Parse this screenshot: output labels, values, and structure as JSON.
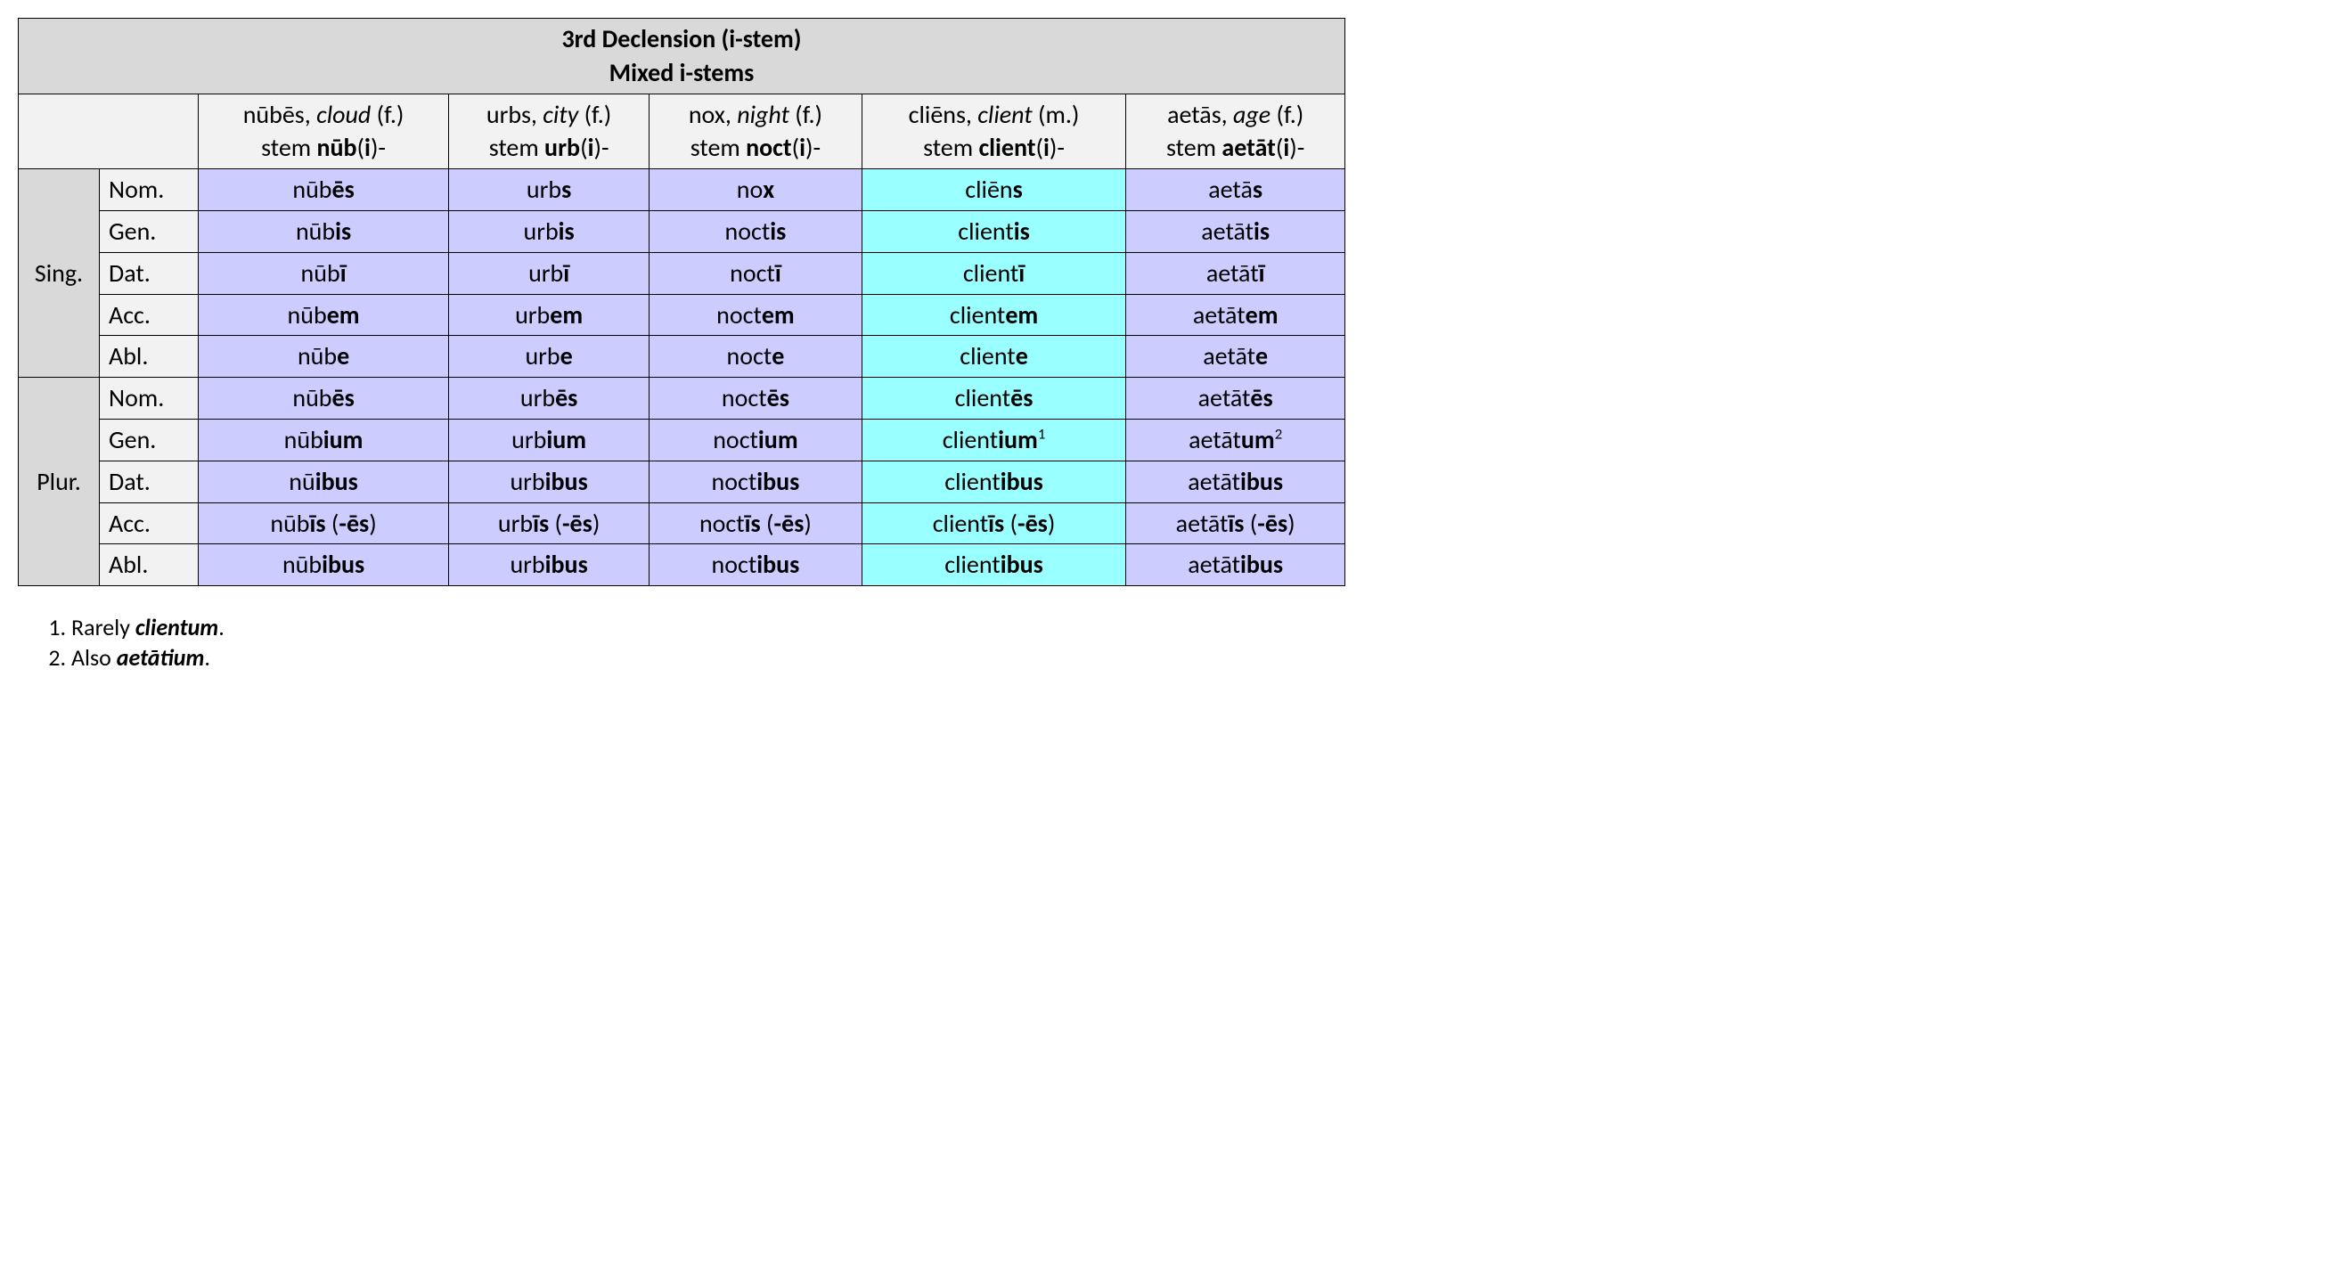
{
  "title_line1": "3rd Declension (i-stem)",
  "title_line2": "Mixed i-stems",
  "headers": [
    {
      "word": "nūbēs",
      "gloss": "cloud",
      "gender": "(f.)",
      "stem_pre": "nūb",
      "stem_i": "i"
    },
    {
      "word": "urbs",
      "gloss": "city",
      "gender": "(f.)",
      "stem_pre": "urb",
      "stem_i": "i"
    },
    {
      "word": "nox",
      "gloss": "night",
      "gender": "(f.)",
      "stem_pre": "noct",
      "stem_i": "i"
    },
    {
      "word": "cliēns",
      "gloss": "client",
      "gender": "(m.)",
      "stem_pre": "client",
      "stem_i": "i"
    },
    {
      "word": "aetās",
      "gloss": "age",
      "gender": "(f.)",
      "stem_pre": "aetāt",
      "stem_i": "i"
    }
  ],
  "number_labels": {
    "sing": "Sing.",
    "plur": "Plur."
  },
  "cases": [
    "Nom.",
    "Gen.",
    "Dat.",
    "Acc.",
    "Abl."
  ],
  "forms": {
    "sing": [
      [
        {
          "s": "nūb",
          "e": "ēs"
        },
        {
          "s": "urb",
          "e": "s"
        },
        {
          "s": "no",
          "e": "x"
        },
        {
          "s": "cliēn",
          "e": "s"
        },
        {
          "s": "aetā",
          "e": "s"
        }
      ],
      [
        {
          "s": "nūb",
          "e": "is"
        },
        {
          "s": "urb",
          "e": "is"
        },
        {
          "s": "noct",
          "e": "is"
        },
        {
          "s": "client",
          "e": "is"
        },
        {
          "s": "aetāt",
          "e": "is"
        }
      ],
      [
        {
          "s": "nūb",
          "e": "ī"
        },
        {
          "s": "urb",
          "e": "ī"
        },
        {
          "s": "noct",
          "e": "ī"
        },
        {
          "s": "client",
          "e": "ī"
        },
        {
          "s": "aetāt",
          "e": "ī"
        }
      ],
      [
        {
          "s": "nūb",
          "e": "em"
        },
        {
          "s": "urb",
          "e": "em"
        },
        {
          "s": "noct",
          "e": "em"
        },
        {
          "s": "client",
          "e": "em"
        },
        {
          "s": "aetāt",
          "e": "em"
        }
      ],
      [
        {
          "s": "nūb",
          "e": "e"
        },
        {
          "s": "urb",
          "e": "e"
        },
        {
          "s": "noct",
          "e": "e"
        },
        {
          "s": "client",
          "e": "e"
        },
        {
          "s": "aetāt",
          "e": "e"
        }
      ]
    ],
    "plur": [
      [
        {
          "s": "nūb",
          "e": "ēs"
        },
        {
          "s": "urb",
          "e": "ēs"
        },
        {
          "s": "noct",
          "e": "ēs"
        },
        {
          "s": "client",
          "e": "ēs"
        },
        {
          "s": "aetāt",
          "e": "ēs"
        }
      ],
      [
        {
          "s": "nūb",
          "e": "ium"
        },
        {
          "s": "urb",
          "e": "ium"
        },
        {
          "s": "noct",
          "e": "ium"
        },
        {
          "s": "client",
          "e": "ium",
          "sup": "1"
        },
        {
          "s": "aetāt",
          "e": "um",
          "sup": "2"
        }
      ],
      [
        {
          "s": "nū",
          "e": "ibus"
        },
        {
          "s": "urb",
          "e": "ibus"
        },
        {
          "s": "noct",
          "e": "ibus"
        },
        {
          "s": "client",
          "e": "ibus"
        },
        {
          "s": "aetāt",
          "e": "ibus"
        }
      ],
      [
        {
          "s": "nūb",
          "e": "īs",
          "alt": " (-ēs)"
        },
        {
          "s": "urb",
          "e": "īs",
          "alt": " (-ēs)"
        },
        {
          "s": "noct",
          "e": "īs",
          "alt": " (-ēs)"
        },
        {
          "s": "client",
          "e": "īs",
          "alt": " (-ēs)"
        },
        {
          "s": "aetāt",
          "e": "īs",
          "alt": " (-ēs)"
        }
      ],
      [
        {
          "s": "nūb",
          "e": "ibus"
        },
        {
          "s": "urb",
          "e": "ibus"
        },
        {
          "s": "noct",
          "e": "ibus"
        },
        {
          "s": "client",
          "e": "ibus"
        },
        {
          "s": "aetāt",
          "e": "ibus"
        }
      ]
    ]
  },
  "col_colors": [
    "lav",
    "lav",
    "lav",
    "cyn",
    "lav"
  ],
  "footnotes": [
    {
      "pre": "Rarely ",
      "bi": "clientum",
      "post": "."
    },
    {
      "pre": "Also ",
      "bi": "aetātium",
      "post": "."
    }
  ],
  "labels": {
    "stem_prefix": "stem "
  }
}
